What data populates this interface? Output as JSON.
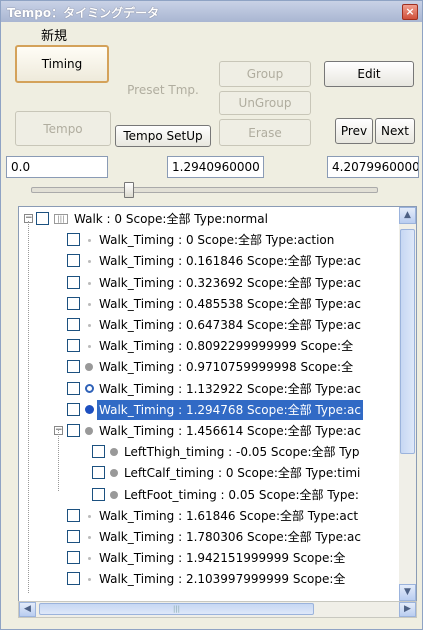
{
  "window": {
    "title": "Tempo：タイミングデータ",
    "close_glyph": "×"
  },
  "menu": {
    "new_label": "新規"
  },
  "buttons": {
    "timing": "Timing",
    "preset_tmp": "Preset Tmp.",
    "group": "Group",
    "edit": "Edit",
    "ungroup": "UnGroup",
    "tempo": "Tempo",
    "tempo_setup": "Tempo SetUp",
    "erase": "Erase",
    "prev": "Prev",
    "next": "Next"
  },
  "fields": {
    "start": "0.0",
    "current": "1.2940960000",
    "end": "4.2079960000"
  },
  "slider": {
    "value_fraction": 0.27
  },
  "tree": {
    "rows": [
      {
        "text": "Walk : 0  Scope:全部  Type:normal",
        "icon": "object-icon",
        "expander": "minus",
        "selected": false
      },
      {
        "text": "Walk_Timing : 0  Scope:全部  Type:action",
        "icon": "small-dot-icon",
        "selected": false
      },
      {
        "text": "Walk_Timing : 0.161846  Scope:全部  Type:ac",
        "icon": "small-dot-icon",
        "selected": false
      },
      {
        "text": "Walk_Timing : 0.323692  Scope:全部  Type:ac",
        "icon": "small-dot-icon",
        "selected": false
      },
      {
        "text": "Walk_Timing : 0.485538  Scope:全部  Type:ac",
        "icon": "small-dot-icon",
        "selected": false
      },
      {
        "text": "Walk_Timing : 0.647384  Scope:全部  Type:ac",
        "icon": "small-dot-icon",
        "selected": false
      },
      {
        "text": "Walk_Timing : 0.8092299999999  Scope:全",
        "icon": "small-dot-icon",
        "selected": false
      },
      {
        "text": "Walk_Timing : 0.9710759999998  Scope:全",
        "icon": "grey-dot-icon",
        "selected": false
      },
      {
        "text": "Walk_Timing : 1.132922  Scope:全部  Type:ac",
        "icon": "ring-dot-icon",
        "selected": false
      },
      {
        "text": "Walk_Timing : 1.294768  Scope:全部  Type:ac",
        "icon": "blue-dot-icon",
        "selected": true
      },
      {
        "text": "Walk_Timing : 1.456614  Scope:全部  Type:ac",
        "icon": "grey-dot-icon",
        "expander": "minus",
        "selected": false
      },
      {
        "text": "LeftThigh_timing : -0.05  Scope:全部  Typ",
        "icon": "grey-dot-icon",
        "child": true,
        "selected": false
      },
      {
        "text": "LeftCalf_timing : 0  Scope:全部  Type:timi",
        "icon": "grey-dot-icon",
        "child": true,
        "selected": false
      },
      {
        "text": "LeftFoot_timing : 0.05  Scope:全部  Type:",
        "icon": "grey-dot-icon",
        "child": true,
        "selected": false
      },
      {
        "text": "Walk_Timing : 1.61846  Scope:全部  Type:act",
        "icon": "small-dot-icon",
        "selected": false
      },
      {
        "text": "Walk_Timing : 1.780306  Scope:全部  Type:ac",
        "icon": "small-dot-icon",
        "selected": false
      },
      {
        "text": "Walk_Timing : 1.942151999999  Scope:全",
        "icon": "small-dot-icon",
        "selected": false
      },
      {
        "text": "Walk_Timing : 2.103997999999  Scope:全",
        "icon": "small-dot-icon",
        "selected": false
      }
    ]
  },
  "colors": {
    "selection": "#316ac5",
    "checkbox_border": "#1c5180",
    "scroll_accent": "#b9cdf0"
  }
}
